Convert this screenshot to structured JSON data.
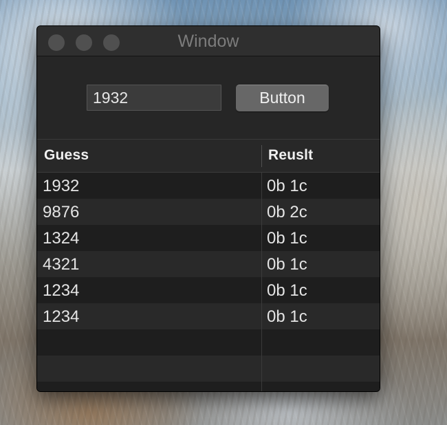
{
  "window": {
    "title": "Window"
  },
  "toolbar": {
    "guess_input_value": "1932",
    "button_label": "Button"
  },
  "table": {
    "columns": [
      "Guess",
      "Reuslt"
    ],
    "rows": [
      {
        "guess": "1932",
        "result": "0b 1c"
      },
      {
        "guess": "9876",
        "result": "0b 2c"
      },
      {
        "guess": "1324",
        "result": "0b 1c"
      },
      {
        "guess": "4321",
        "result": "0b 1c"
      },
      {
        "guess": "1234",
        "result": "0b 1c"
      },
      {
        "guess": "1234",
        "result": "0b 1c"
      }
    ]
  }
}
